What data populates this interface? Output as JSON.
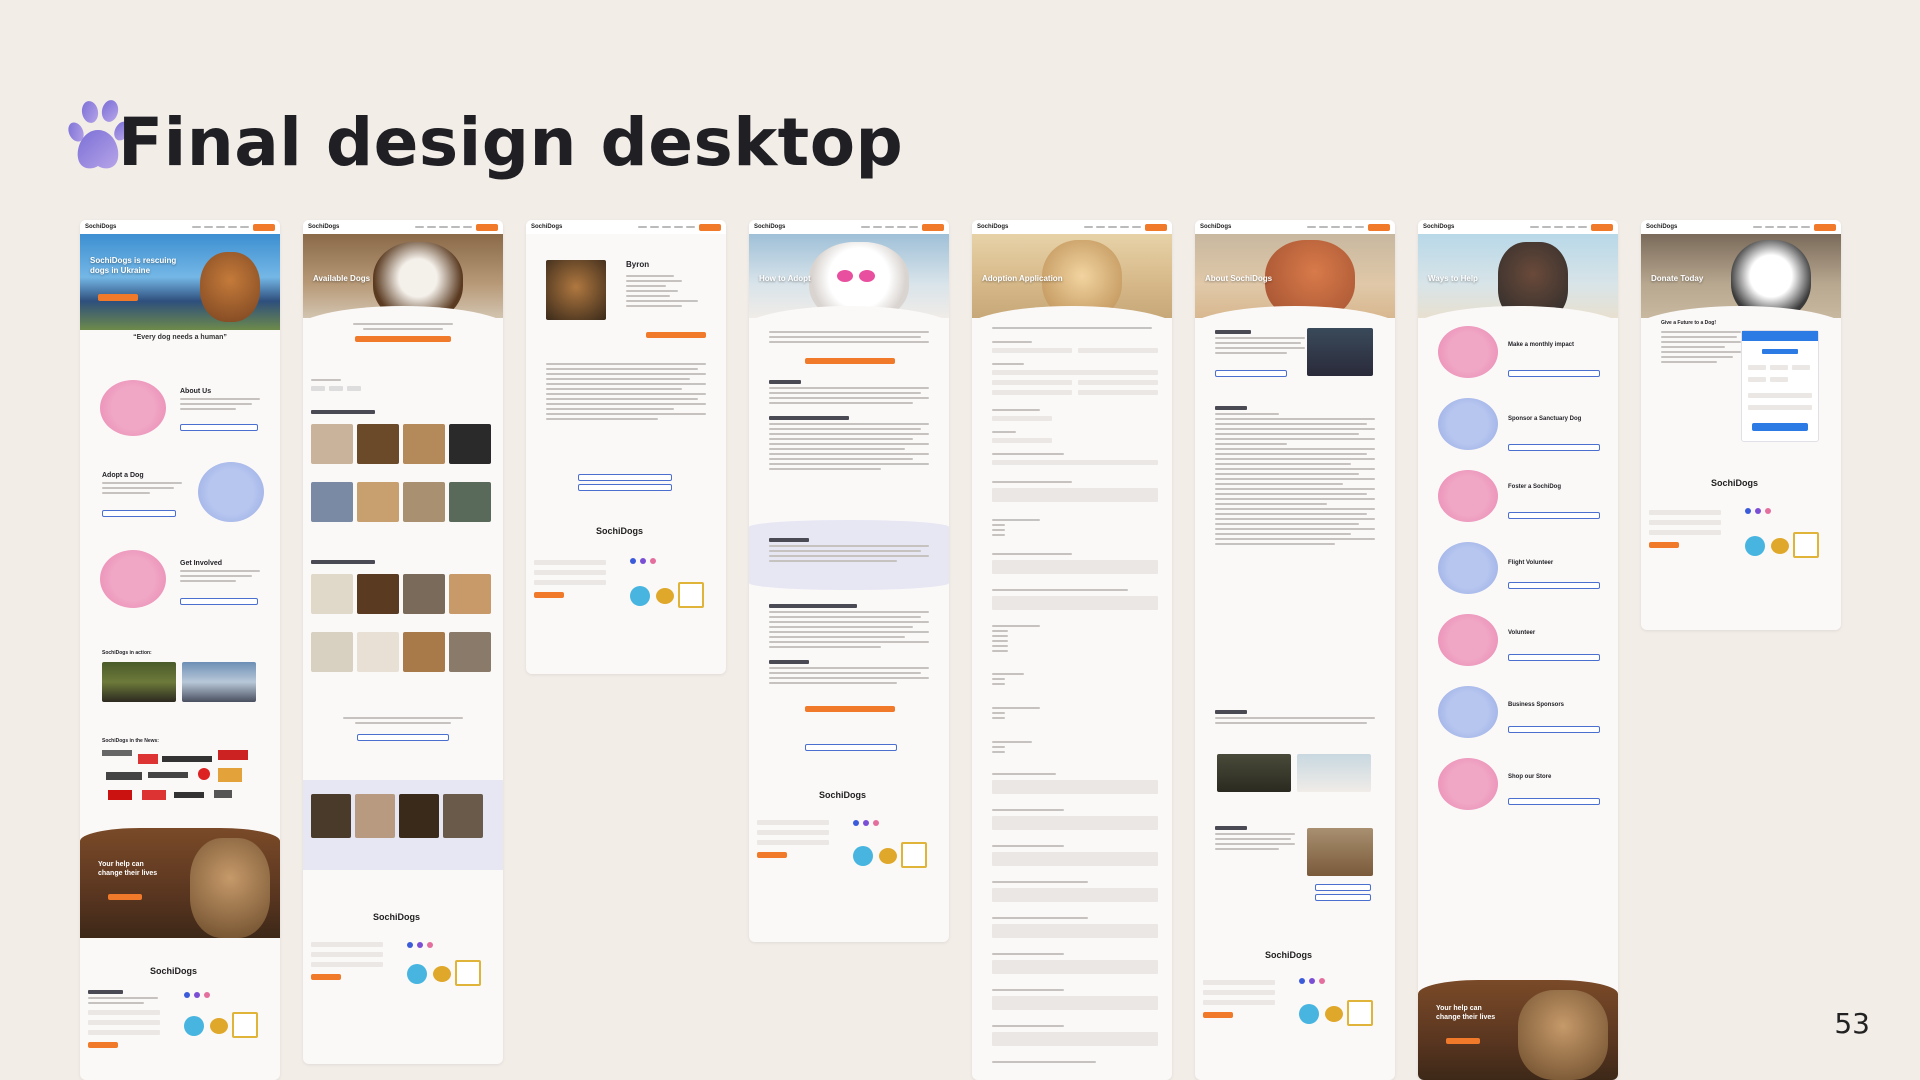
{
  "slide": {
    "title": "Final design desktop",
    "page_number": "53"
  },
  "icons": {
    "paw": "paw-icon"
  },
  "colors": {
    "background": "#f3ede8",
    "accent": "#f07a2a",
    "purple": "#7a6fd6",
    "pink": "#e7a4c3"
  },
  "mockups": [
    {
      "id": "home",
      "hero_title": "SochiDogs is rescuing dogs in Ukraine",
      "tagline": "“Every dog needs a human”",
      "sections": [
        "About Us",
        "Adopt a Dog",
        "Get Involved"
      ],
      "in_action": "SochiDogs in action:",
      "in_news": "SochiDogs in the News:",
      "banner_text": "Your help can change their lives",
      "footer_logo": "SochiDogs"
    },
    {
      "id": "available-dogs",
      "hero_title": "Available Dogs",
      "footer_logo": "SochiDogs"
    },
    {
      "id": "dog-profile",
      "dog_name": "Byron",
      "footer_logo": "SochiDogs"
    },
    {
      "id": "how-to-adopt",
      "hero_title": "How to Adopt",
      "footer_logo": "SochiDogs"
    },
    {
      "id": "adoption-application",
      "hero_title": "Adoption Application"
    },
    {
      "id": "about",
      "hero_title": "About SochiDogs",
      "footer_logo": "SochiDogs"
    },
    {
      "id": "ways-to-help",
      "hero_title": "Ways to Help",
      "items": [
        "Make a monthly impact",
        "Sponsor a Sanctuary Dog",
        "Foster a SochiDog",
        "Flight Volunteer",
        "Volunteer",
        "Business Sponsors",
        "Shop our Store"
      ],
      "banner_text": "Your help can change their lives"
    },
    {
      "id": "donate",
      "hero_title": "Donate Today",
      "side_title": "Give a Future to a Dog!",
      "footer_logo": "SochiDogs"
    }
  ]
}
